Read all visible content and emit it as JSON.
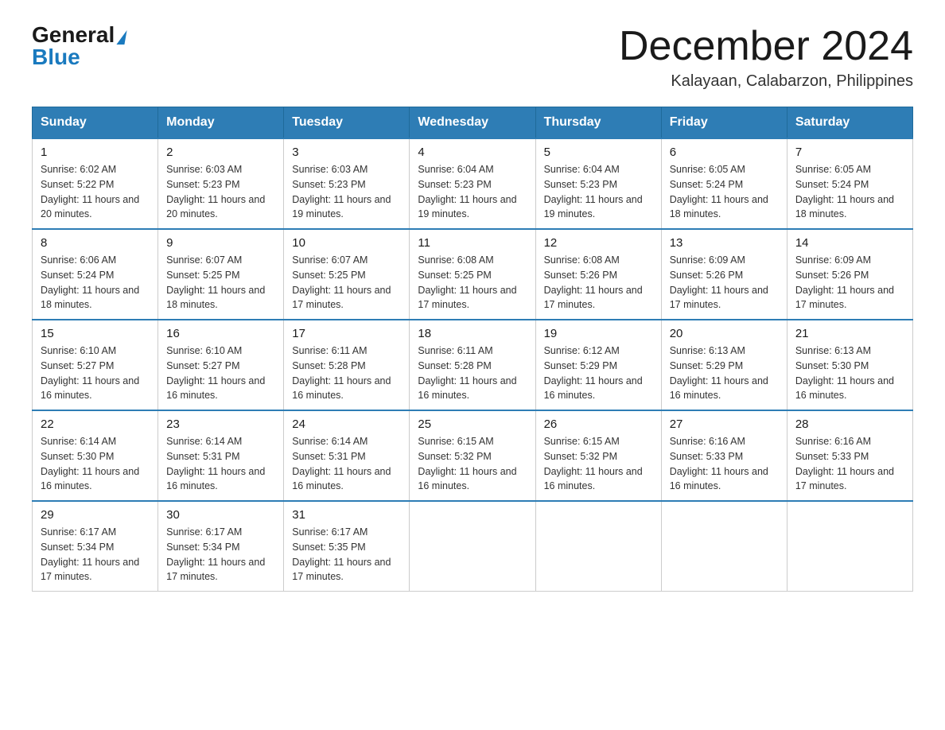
{
  "header": {
    "logo": {
      "general": "General",
      "blue": "Blue"
    },
    "title": "December 2024",
    "location": "Kalayaan, Calabarzon, Philippines"
  },
  "weekdays": [
    "Sunday",
    "Monday",
    "Tuesday",
    "Wednesday",
    "Thursday",
    "Friday",
    "Saturday"
  ],
  "weeks": [
    [
      {
        "day": "1",
        "sunrise": "6:02 AM",
        "sunset": "5:22 PM",
        "daylight": "11 hours and 20 minutes."
      },
      {
        "day": "2",
        "sunrise": "6:03 AM",
        "sunset": "5:23 PM",
        "daylight": "11 hours and 20 minutes."
      },
      {
        "day": "3",
        "sunrise": "6:03 AM",
        "sunset": "5:23 PM",
        "daylight": "11 hours and 19 minutes."
      },
      {
        "day": "4",
        "sunrise": "6:04 AM",
        "sunset": "5:23 PM",
        "daylight": "11 hours and 19 minutes."
      },
      {
        "day": "5",
        "sunrise": "6:04 AM",
        "sunset": "5:23 PM",
        "daylight": "11 hours and 19 minutes."
      },
      {
        "day": "6",
        "sunrise": "6:05 AM",
        "sunset": "5:24 PM",
        "daylight": "11 hours and 18 minutes."
      },
      {
        "day": "7",
        "sunrise": "6:05 AM",
        "sunset": "5:24 PM",
        "daylight": "11 hours and 18 minutes."
      }
    ],
    [
      {
        "day": "8",
        "sunrise": "6:06 AM",
        "sunset": "5:24 PM",
        "daylight": "11 hours and 18 minutes."
      },
      {
        "day": "9",
        "sunrise": "6:07 AM",
        "sunset": "5:25 PM",
        "daylight": "11 hours and 18 minutes."
      },
      {
        "day": "10",
        "sunrise": "6:07 AM",
        "sunset": "5:25 PM",
        "daylight": "11 hours and 17 minutes."
      },
      {
        "day": "11",
        "sunrise": "6:08 AM",
        "sunset": "5:25 PM",
        "daylight": "11 hours and 17 minutes."
      },
      {
        "day": "12",
        "sunrise": "6:08 AM",
        "sunset": "5:26 PM",
        "daylight": "11 hours and 17 minutes."
      },
      {
        "day": "13",
        "sunrise": "6:09 AM",
        "sunset": "5:26 PM",
        "daylight": "11 hours and 17 minutes."
      },
      {
        "day": "14",
        "sunrise": "6:09 AM",
        "sunset": "5:26 PM",
        "daylight": "11 hours and 17 minutes."
      }
    ],
    [
      {
        "day": "15",
        "sunrise": "6:10 AM",
        "sunset": "5:27 PM",
        "daylight": "11 hours and 16 minutes."
      },
      {
        "day": "16",
        "sunrise": "6:10 AM",
        "sunset": "5:27 PM",
        "daylight": "11 hours and 16 minutes."
      },
      {
        "day": "17",
        "sunrise": "6:11 AM",
        "sunset": "5:28 PM",
        "daylight": "11 hours and 16 minutes."
      },
      {
        "day": "18",
        "sunrise": "6:11 AM",
        "sunset": "5:28 PM",
        "daylight": "11 hours and 16 minutes."
      },
      {
        "day": "19",
        "sunrise": "6:12 AM",
        "sunset": "5:29 PM",
        "daylight": "11 hours and 16 minutes."
      },
      {
        "day": "20",
        "sunrise": "6:13 AM",
        "sunset": "5:29 PM",
        "daylight": "11 hours and 16 minutes."
      },
      {
        "day": "21",
        "sunrise": "6:13 AM",
        "sunset": "5:30 PM",
        "daylight": "11 hours and 16 minutes."
      }
    ],
    [
      {
        "day": "22",
        "sunrise": "6:14 AM",
        "sunset": "5:30 PM",
        "daylight": "11 hours and 16 minutes."
      },
      {
        "day": "23",
        "sunrise": "6:14 AM",
        "sunset": "5:31 PM",
        "daylight": "11 hours and 16 minutes."
      },
      {
        "day": "24",
        "sunrise": "6:14 AM",
        "sunset": "5:31 PM",
        "daylight": "11 hours and 16 minutes."
      },
      {
        "day": "25",
        "sunrise": "6:15 AM",
        "sunset": "5:32 PM",
        "daylight": "11 hours and 16 minutes."
      },
      {
        "day": "26",
        "sunrise": "6:15 AM",
        "sunset": "5:32 PM",
        "daylight": "11 hours and 16 minutes."
      },
      {
        "day": "27",
        "sunrise": "6:16 AM",
        "sunset": "5:33 PM",
        "daylight": "11 hours and 16 minutes."
      },
      {
        "day": "28",
        "sunrise": "6:16 AM",
        "sunset": "5:33 PM",
        "daylight": "11 hours and 17 minutes."
      }
    ],
    [
      {
        "day": "29",
        "sunrise": "6:17 AM",
        "sunset": "5:34 PM",
        "daylight": "11 hours and 17 minutes."
      },
      {
        "day": "30",
        "sunrise": "6:17 AM",
        "sunset": "5:34 PM",
        "daylight": "11 hours and 17 minutes."
      },
      {
        "day": "31",
        "sunrise": "6:17 AM",
        "sunset": "5:35 PM",
        "daylight": "11 hours and 17 minutes."
      },
      null,
      null,
      null,
      null
    ]
  ]
}
